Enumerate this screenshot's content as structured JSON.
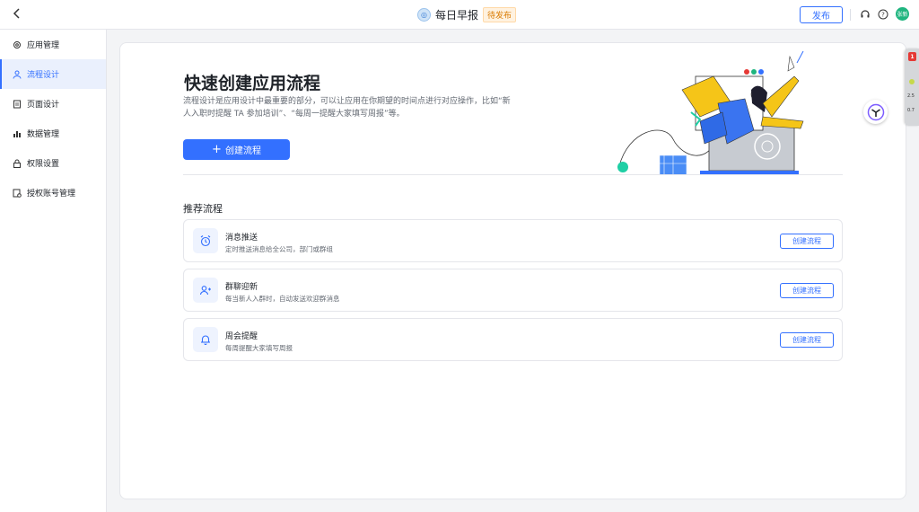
{
  "topbar": {
    "back_icon": "chevron-left-icon",
    "app_title": "每日早报",
    "status": "待发布",
    "publish_label": "发布",
    "user_initials": "张新"
  },
  "sidebar": {
    "items": [
      {
        "label": "应用管理",
        "icon": "gear-icon",
        "active": false
      },
      {
        "label": "流程设计",
        "icon": "flow-icon",
        "active": true
      },
      {
        "label": "页面设计",
        "icon": "page-icon",
        "active": false
      },
      {
        "label": "数据管理",
        "icon": "chart-icon",
        "active": false
      },
      {
        "label": "权限设置",
        "icon": "lock-icon",
        "active": false
      },
      {
        "label": "授权账号管理",
        "icon": "account-icon",
        "active": false
      }
    ]
  },
  "hero": {
    "title": "快速创建应用流程",
    "description": "流程设计是应用设计中最重要的部分，可以让应用在你期望的时间点进行对应操作，比如“新人入职时提醒 TA 参加培训”、“每周一提醒大家填写周报”等。",
    "create_label": "创建流程"
  },
  "recommended": {
    "title": "推荐流程",
    "flows": [
      {
        "name": "消息推送",
        "desc": "定时推送消息给全公司，部门或群组",
        "icon": "alarm-clock-icon",
        "button": "创建流程"
      },
      {
        "name": "群聊迎新",
        "desc": "每当新人入群时，自动发送欢迎群消息",
        "icon": "add-user-icon",
        "button": "创建流程"
      },
      {
        "name": "周会提醒",
        "desc": "每周提醒大家填写周报",
        "icon": "bell-icon",
        "button": "创建流程"
      }
    ]
  },
  "side_widget": {
    "badge": "1",
    "values": [
      "2.5",
      "0.7"
    ]
  },
  "colors": {
    "primary": "#3370ff",
    "status_bg": "#fff2e0",
    "status_text": "#d97a00",
    "avatar": "#1fb57f"
  }
}
